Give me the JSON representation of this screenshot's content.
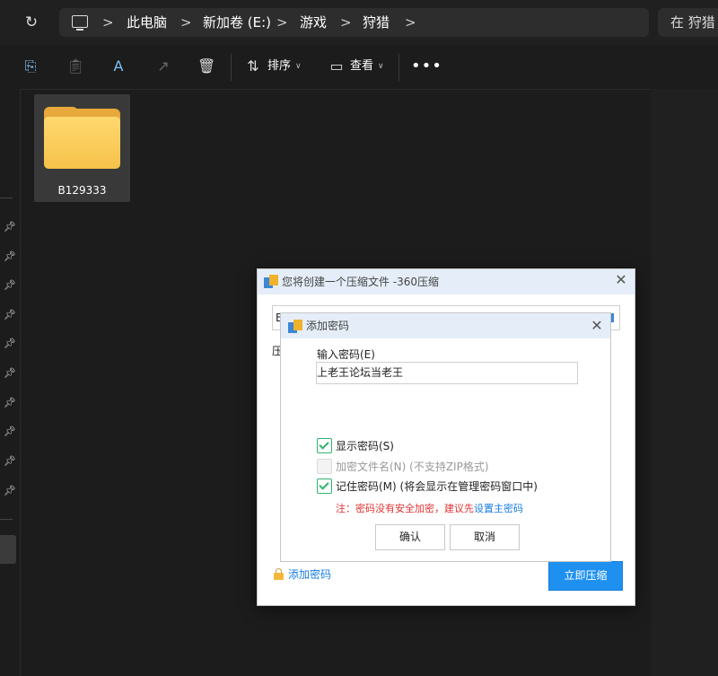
{
  "window": {
    "refresh_icon": "refresh-icon",
    "breadcrumb": {
      "separator": ">",
      "items": [
        "此电脑",
        "新加卷 (E:)",
        "游戏",
        "狩猎"
      ]
    },
    "search": {
      "text": "在 狩猎"
    }
  },
  "toolbar": {
    "icons": [
      "copy-icon",
      "paste-icon",
      "rename-icon",
      "share-icon",
      "delete-icon"
    ],
    "sort_label": "排序",
    "view_label": "查看",
    "more_label": "•••"
  },
  "content": {
    "folder": {
      "name": "B129333"
    }
  },
  "dialog_360": {
    "title": "您将创建一个压缩文件 -360压缩",
    "path_fragment": "B",
    "side_fragment": "压",
    "add_password_link": "添加密码",
    "compress_button": "立即压缩"
  },
  "dialog_password": {
    "title": "添加密码",
    "input_label": "输入密码(E)",
    "input_value": "上老王论坛当老王",
    "options": [
      {
        "label": "显示密码(S)",
        "checked": true,
        "enabled": true
      },
      {
        "label": "加密文件名(N) (不支持ZIP格式)",
        "checked": false,
        "enabled": false
      },
      {
        "label": "记住密码(M) (将会显示在管理密码窗口中)",
        "checked": true,
        "enabled": true
      }
    ],
    "warning_text": "注：密码没有安全加密，建议先",
    "warning_link": "设置主密码",
    "ok_button": "确认",
    "cancel_button": "取消"
  },
  "colors": {
    "accent": "#1e90f0",
    "warning": "#e23131",
    "check": "#2fb36d",
    "folder": "#f6c24a"
  }
}
